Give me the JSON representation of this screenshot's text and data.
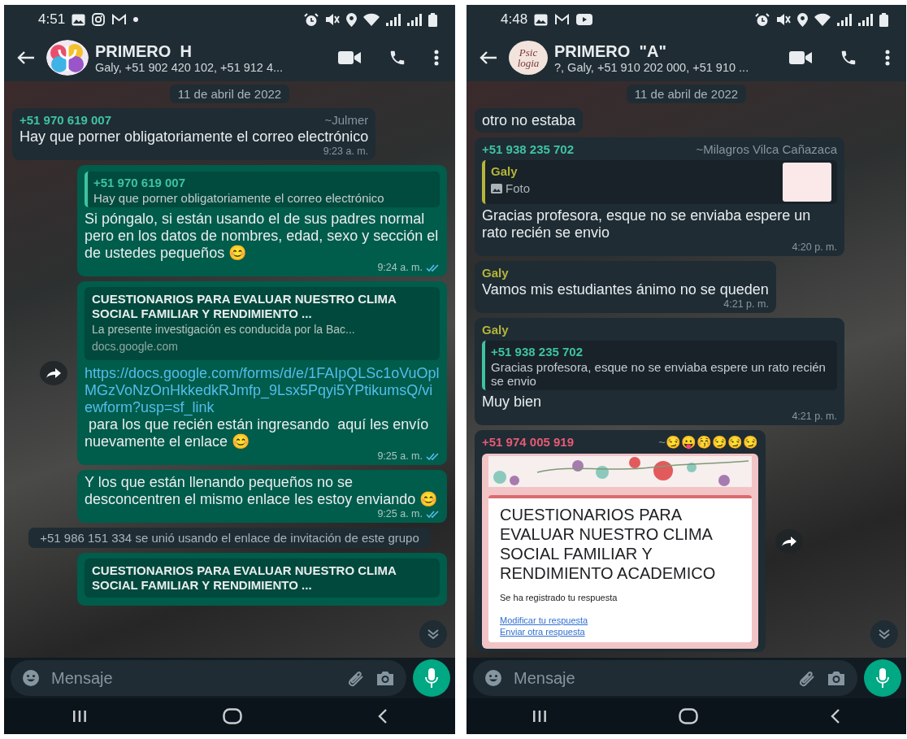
{
  "phones": [
    {
      "status": {
        "time": "4:51",
        "notifications": [
          {
            "kind": "gallery"
          },
          {
            "kind": "instagram"
          },
          {
            "kind": "gmail"
          },
          {
            "kind": "dot"
          }
        ]
      },
      "header": {
        "title": "PRIMERO  H",
        "subtitle": "Galy, +51 902 420 102, +51 912 4...",
        "avatar": {
          "kind": "psi"
        }
      },
      "date": "11 de abril de 2022",
      "messages": [
        {
          "kind": "incoming",
          "sender": "+51 970 619 007",
          "color": "#3fc3a1",
          "alias": "~Julmer",
          "text": "Hay que porner obligatoriamente el correo electrónico",
          "time": "9:23 a. m."
        },
        {
          "kind": "outgoing",
          "quote": {
            "kind": "text",
            "sender": "+51 970 619 007",
            "color": "#3fc3a1",
            "text": "Hay que porner obligatoriamente el correo electrónico"
          },
          "text": "Si póngalo, si están usando el de sus padres normal pero en los datos de nombres, edad, sexo y sección el de ustedes pequeños 😊",
          "time": "9:24 a. m.",
          "read": true
        },
        {
          "kind": "outgoing",
          "forward": true,
          "preview": {
            "title": "CUESTIONARIOS PARA EVALUAR NUESTRO CLIMA SOCIAL FAMILIAR Y RENDIMIENTO ...",
            "description": "La presente investigación es conducida por la Bac...",
            "domain": "docs.google.com"
          },
          "link": "https://docs.google.com/forms/d/e/1FAIpQLSc1oVuOplMGzVoNzOnHkkedkRJmfp_9Lsx5Pqyi5YPtikumsQ/viewform?usp=sf_link",
          "text": " para los que recién están ingresando  aquí les envío nuevamente el enlace 😊",
          "time": "9:25 a. m.",
          "read": true
        },
        {
          "kind": "outgoing",
          "text": "Y los que están llenando pequeños no se desconcentren el mismo enlace les estoy enviando 😊",
          "time": "9:25 a. m.",
          "read": true
        },
        {
          "kind": "system",
          "text": "+51 986 151 334 se unió usando el enlace de invitación de este grupo"
        },
        {
          "kind": "outgoing",
          "preview": {
            "title": "CUESTIONARIOS PARA EVALUAR NUESTRO CLIMA SOCIAL FAMILIAR Y RENDIMIENTO ..."
          }
        }
      ],
      "input": {
        "placeholder": "Mensaje"
      }
    },
    {
      "status": {
        "time": "4:48",
        "notifications": [
          {
            "kind": "gallery"
          },
          {
            "kind": "gmail"
          },
          {
            "kind": "youtube"
          }
        ]
      },
      "header": {
        "title": "PRIMERO  \"A\"",
        "subtitle": "?, Galy, +51 910 202 000, +51 910 ...",
        "avatar": {
          "kind": "logo",
          "lines": [
            "Psic",
            "logia"
          ]
        }
      },
      "date": "11 de abril de 2022",
      "messages": [
        {
          "kind": "incoming",
          "text": "otro no estaba"
        },
        {
          "kind": "incoming",
          "sender": "+51 938 235 702",
          "color": "#3fc3a1",
          "alias": "~Milagros Vilca Cañazaca",
          "quote": {
            "kind": "photo",
            "sender": "Galy",
            "color": "#b5b53a",
            "text": "Foto"
          },
          "text": "Gracias profesora, esque no se enviaba espere un rato recién se envio",
          "time": "4:20 p. m."
        },
        {
          "kind": "incoming",
          "sender": "Galy",
          "color": "#b5b53a",
          "text": "Vamos mis estudiantes ánimo no se queden",
          "time": "4:21 p. m."
        },
        {
          "kind": "incoming",
          "sender": "Galy",
          "color": "#b5b53a",
          "quote": {
            "kind": "text",
            "sender": "+51 938 235 702",
            "color": "#3fc3a1",
            "text": "Gracias profesora, esque no se enviaba espere un rato recién se envio"
          },
          "text": "Muy bien",
          "time": "4:21 p. m."
        },
        {
          "kind": "incoming",
          "forward": true,
          "sender": "+51 974 005 919",
          "color": "#e85a75",
          "alias": "~😏😛😚😏😏😏",
          "image": {
            "title": "CUESTIONARIOS PARA EVALUAR NUESTRO CLIMA SOCIAL FAMILIAR Y RENDIMIENTO ACADEMICO",
            "note": "Se ha registrado tu respuesta",
            "links": [
              "Modificar tu respuesta",
              "Enviar otra respuesta"
            ]
          }
        }
      ],
      "input": {
        "placeholder": "Mensaje"
      }
    }
  ]
}
